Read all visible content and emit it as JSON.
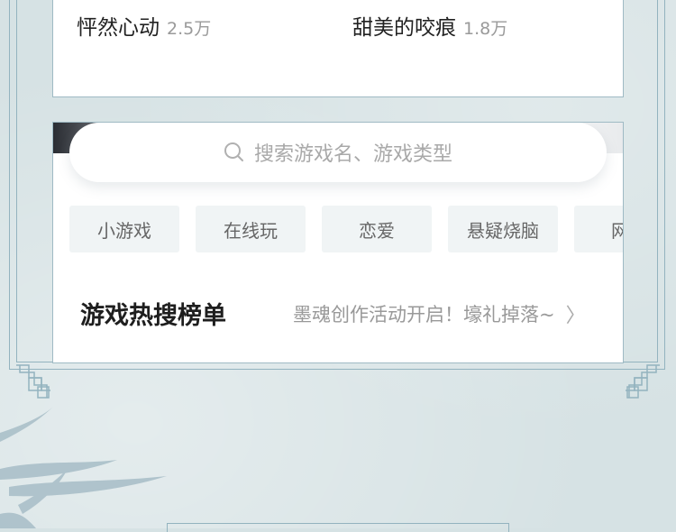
{
  "ranking": {
    "items": [
      {
        "name": "怦然心动",
        "count": "2.5万"
      },
      {
        "name": "甜美的咬痕",
        "count": "1.8万"
      }
    ]
  },
  "search": {
    "placeholder": "搜索游戏名、游戏类型"
  },
  "tags": [
    "小游戏",
    "在线玩",
    "恋爱",
    "悬疑烧脑",
    "网红"
  ],
  "hot": {
    "title": "游戏热搜榜单",
    "notice": "墨魂创作活动开启！壕礼掉落~",
    "chevron": "〉"
  },
  "colors": {
    "background": "#d6e2e4",
    "frame": "#93b3bf",
    "tag_bg": "#f0f4f5"
  }
}
